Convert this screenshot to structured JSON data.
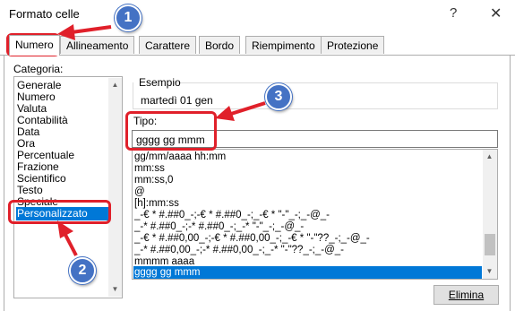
{
  "window": {
    "title": "Formato celle",
    "help": "?",
    "close": "✕"
  },
  "tabs": [
    {
      "label": "Numero",
      "active": true
    },
    {
      "label": "Allineamento",
      "active": false
    },
    {
      "label": "Carattere",
      "active": false
    },
    {
      "label": "Bordo",
      "active": false
    },
    {
      "label": "Riempimento",
      "active": false
    },
    {
      "label": "Protezione",
      "active": false
    }
  ],
  "categoria": {
    "label": "Categoria:",
    "items": [
      "Generale",
      "Numero",
      "Valuta",
      "Contabilità",
      "Data",
      "Ora",
      "Percentuale",
      "Frazione",
      "Scientifico",
      "Testo",
      "Speciale",
      "Personalizzato"
    ],
    "selected": "Personalizzato"
  },
  "esempio": {
    "label": "Esempio",
    "value": "martedì 01 gen"
  },
  "tipo": {
    "label": "Tipo:",
    "value": "gggg gg mmm",
    "list": [
      "gg/mm/aaaa hh:mm",
      "mm:ss",
      "mm:ss,0",
      "@",
      "[h]:mm:ss",
      "_-€ * #.##0_-;-€ * #.##0_-;_-€ * \"-\"_-;_-@_-",
      "_-* #.##0_-;-* #.##0_-;_-* \"-\"_-;_-@_-",
      "_-€ * #.##0,00_-;-€ * #.##0,00_-;_-€ * \"-\"??_-;_-@_-",
      "_-* #.##0,00_-;-* #.##0,00_-;_-* \"-\"??_-;_-@_-",
      "mmmm aaaa",
      "gggg gg mmm"
    ],
    "selected": "gggg gg mmm"
  },
  "buttons": {
    "elimina": "Elimina"
  },
  "callouts": [
    "1",
    "2",
    "3"
  ],
  "colors": {
    "selection": "#0078d7",
    "highlight": "#e0202a",
    "callout": "#4472c4"
  },
  "icons": {
    "scroll_up": "▲",
    "scroll_down": "▼"
  }
}
